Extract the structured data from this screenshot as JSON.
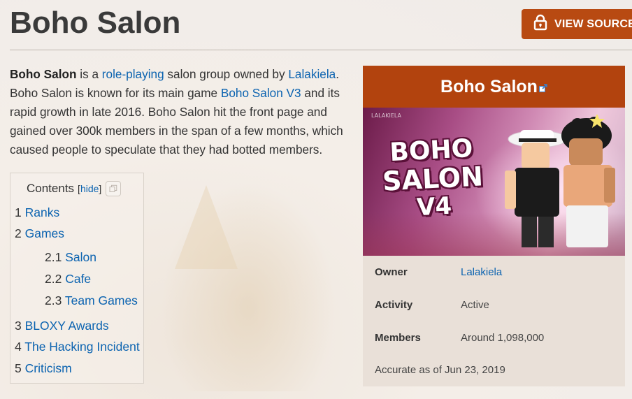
{
  "page": {
    "title": "Boho Salon",
    "view_source_label": "VIEW SOURCE"
  },
  "intro": {
    "bold_name": "Boho Salon",
    "t1": " is a ",
    "link_roleplaying": "role-playing",
    "t2": " salon group owned by ",
    "link_owner": "Lalakiela",
    "t3": ". Boho Salon is known for its main game ",
    "link_game": "Boho Salon V3",
    "t4": " and its rapid growth in late 2016. Boho Salon hit the front page and gained over 300k members in the span of a few months, which caused people to speculate that they had botted members."
  },
  "toc": {
    "heading": "Contents",
    "hide_open": "[",
    "hide_label": "hide",
    "hide_close": "]",
    "items": [
      {
        "num": "1",
        "label": "Ranks"
      },
      {
        "num": "2",
        "label": "Games"
      },
      {
        "num": "2.1",
        "label": "Salon"
      },
      {
        "num": "2.2",
        "label": "Cafe"
      },
      {
        "num": "2.3",
        "label": "Team Games"
      },
      {
        "num": "3",
        "label": "BLOXY Awards"
      },
      {
        "num": "4",
        "label": "The Hacking Incident"
      },
      {
        "num": "5",
        "label": "Criticism"
      }
    ]
  },
  "infobox": {
    "title": "Boho Salon",
    "image_text": {
      "l1": "BOHO",
      "l2": "SALON",
      "l3": "V4",
      "watermark": "LALAKIELA"
    },
    "rows": [
      {
        "label": "Owner",
        "value": "Lalakiela"
      },
      {
        "label": "Activity",
        "value": "Active"
      },
      {
        "label": "Members",
        "value": "Around 1,098,000"
      }
    ],
    "footnote": "Accurate as of Jun 23, 2019"
  },
  "colors": {
    "accent": "#b2430e",
    "button": "#b84a12",
    "link": "#0b63b0"
  },
  "icons": [
    "lock-icon",
    "external-link-icon",
    "copy-icon"
  ]
}
